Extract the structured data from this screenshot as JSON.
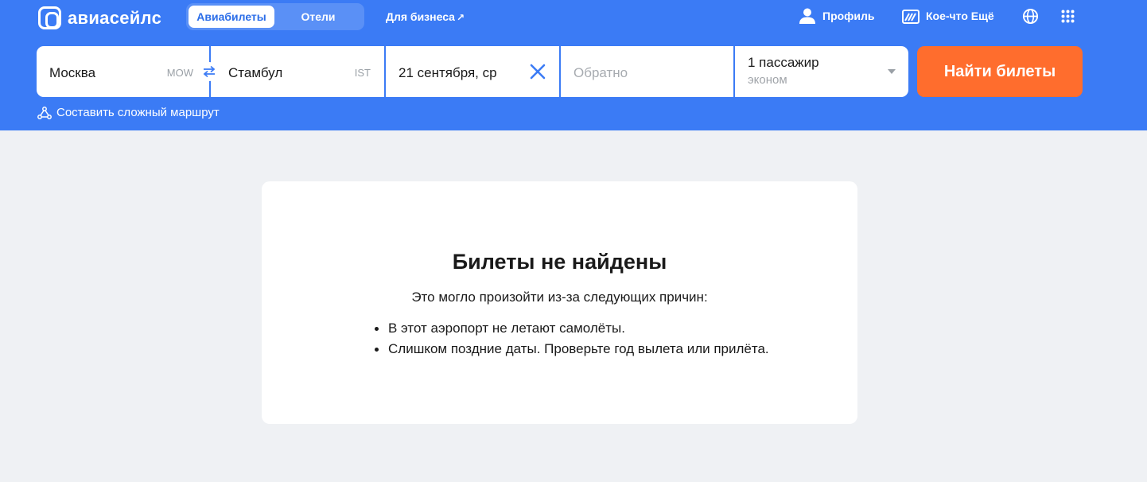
{
  "brand": {
    "name": "авиасейлс"
  },
  "tabs": [
    {
      "label": "Авиабилеты",
      "active": true
    },
    {
      "label": "Отели",
      "active": false
    }
  ],
  "nav": {
    "business": "Для бизнеса",
    "profile": "Профиль",
    "more": "Кое-что Ещё"
  },
  "search": {
    "from": {
      "city": "Москва",
      "code": "MOW"
    },
    "to": {
      "city": "Стамбул",
      "code": "IST"
    },
    "depart_date": "21 сентября, ср",
    "return_placeholder": "Обратно",
    "passengers": "1 пассажир",
    "class": "эконом",
    "button": "Найти билеты",
    "complex_route": "Составить сложный маршрут"
  },
  "result": {
    "title": "Билеты не найдены",
    "subtitle": "Это могло произойти из-за следующих причин:",
    "reasons": [
      "В этот аэропорт не летают самолёты.",
      "Слишком поздние даты. Проверьте год вылета или прилёта."
    ]
  },
  "colors": {
    "header": "#3b7bf5",
    "button": "#ff6d2d",
    "background": "#eff1f4"
  }
}
